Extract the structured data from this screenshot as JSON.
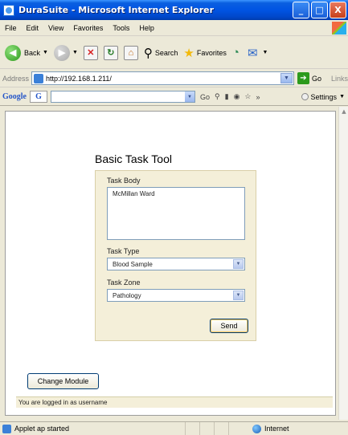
{
  "window": {
    "title": "DuraSuite - Microsoft Internet Explorer",
    "controls": [
      "_",
      "□",
      "X"
    ]
  },
  "menu": [
    "File",
    "Edit",
    "View",
    "Favorites",
    "Tools",
    "Help"
  ],
  "toolbar": {
    "back_label": "Back",
    "search_label": "Search",
    "favorites_label": "Favorites"
  },
  "address": {
    "label": "Address",
    "url": "http://192.168.1.211/",
    "go_label": "Go",
    "links_label": "Links"
  },
  "googlebar": {
    "logo": "Google",
    "g_button": "G",
    "go_label": "Go",
    "settings_label": "Settings"
  },
  "page": {
    "title": "Basic Task Tool",
    "task_body_label": "Task Body",
    "task_body_value": "McMillan Ward",
    "task_type_label": "Task Type",
    "task_type_value": "Blood Sample",
    "task_zone_label": "Task Zone",
    "task_zone_value": "Pathology",
    "send_label": "Send",
    "change_module_label": "Change Module",
    "logged_in_text": "You are logged in as username"
  },
  "status": {
    "text": "Applet ap started",
    "zone": "Internet"
  },
  "icons": {
    "back": "back-arrow-icon",
    "forward": "forward-arrow-icon",
    "stop": "stop-icon",
    "refresh": "refresh-icon",
    "home": "home-icon",
    "search": "search-icon",
    "favorites": "favorites-star-icon",
    "history": "history-icon",
    "mail": "mail-icon"
  },
  "colors": {
    "title_bar": "#0054e3",
    "panel_bg": "#f4efd9",
    "chrome_bg": "#ece9d8"
  }
}
